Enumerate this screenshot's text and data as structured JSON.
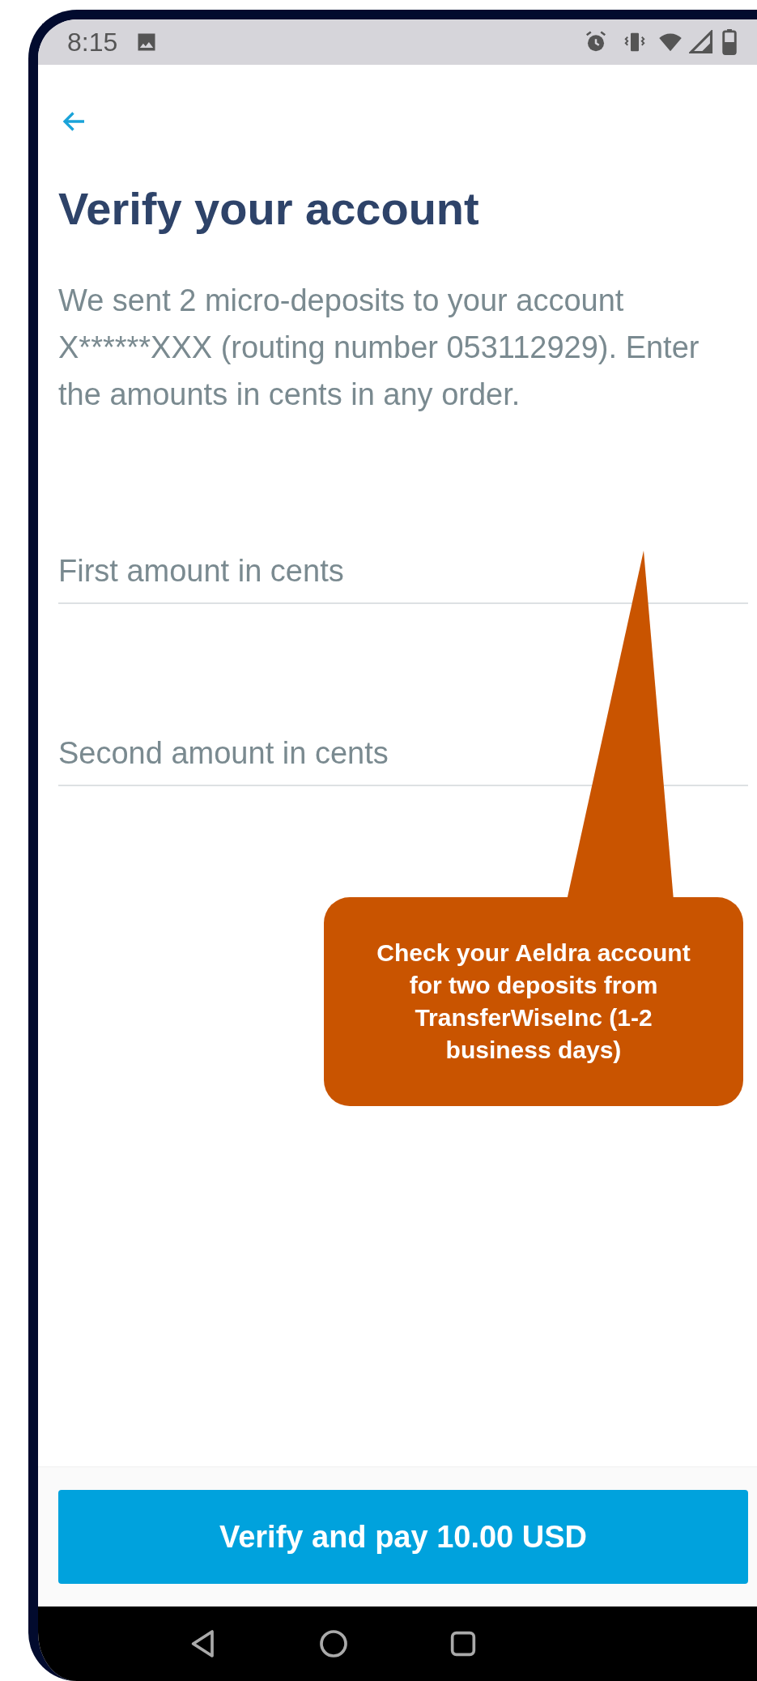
{
  "status_bar": {
    "time": "8:15"
  },
  "title": "Verify your account",
  "description": "We sent 2 micro-deposits to your account X******XXX (routing number 053112929). Enter the amounts in cents in any order.",
  "fields": [
    {
      "placeholder": "First amount in cents"
    },
    {
      "placeholder": "Second amount in cents"
    }
  ],
  "callout": {
    "text": "Check your Aeldra account for two deposits from TransferWiseInc (1-2 business days)"
  },
  "primary_button": "Verify and pay 10.00 USD"
}
